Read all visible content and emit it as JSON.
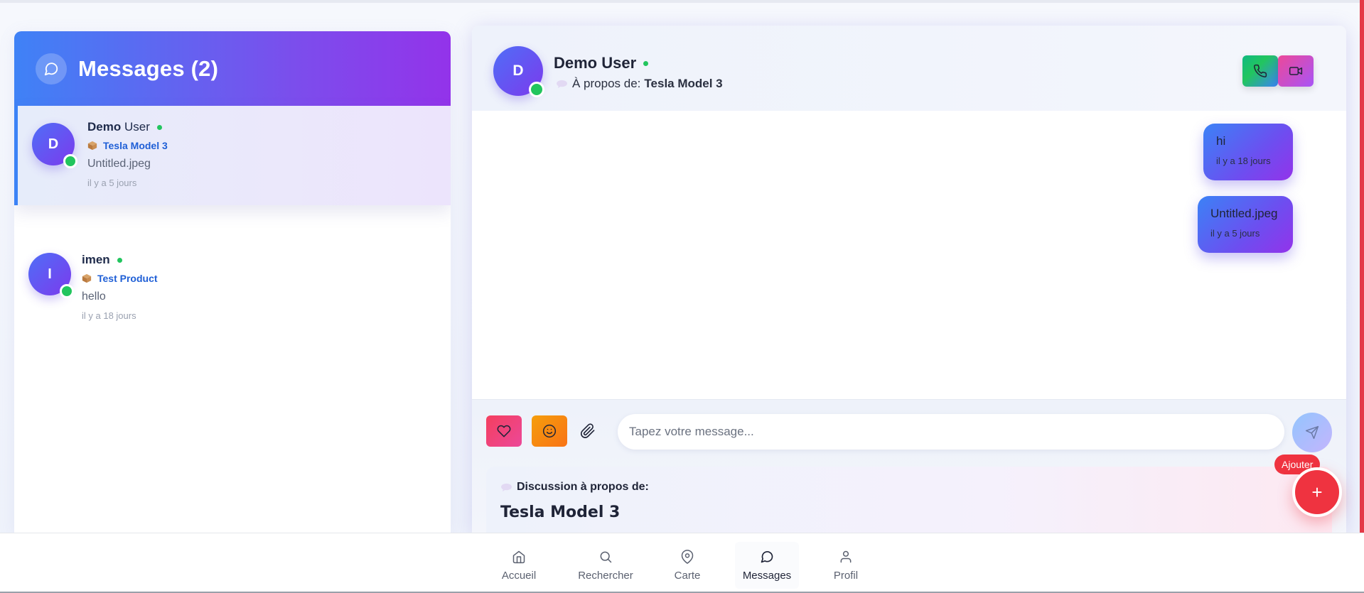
{
  "colors": {
    "accent_blue": "#3b82f6",
    "accent_purple": "#9333ea",
    "online_green": "#22c55e",
    "danger_red": "#ef3340",
    "product_link": "#1f5fd6"
  },
  "conversations": {
    "title": "Messages (2)",
    "items": [
      {
        "initial": "D",
        "name_first": "Demo",
        "name_last": "User",
        "product": "Tesla Model 3",
        "last_message": "Untitled.jpeg",
        "time": "il y a 5 jours",
        "online": true,
        "active": true
      },
      {
        "initial": "I",
        "name": "imen",
        "product": "Test Product",
        "last_message": "hello",
        "time": "il y a 18 jours",
        "online": true,
        "active": false
      }
    ]
  },
  "chat": {
    "contact_initial": "D",
    "contact_name": "Demo User",
    "about_prefix": "À propos de:",
    "about_product": "Tesla Model 3",
    "messages": [
      {
        "text": "hi",
        "time": "il y a 18 jours"
      },
      {
        "text": "Untitled.jpeg",
        "time": "il y a 5 jours"
      }
    ],
    "input_placeholder": "Tapez votre message...",
    "product_card": {
      "label": "Discussion à propos de:",
      "title": "Tesla Model 3"
    }
  },
  "fab": {
    "label": "Ajouter",
    "symbol": "+"
  },
  "nav": {
    "items": [
      {
        "label": "Accueil",
        "icon": "home-icon"
      },
      {
        "label": "Rechercher",
        "icon": "search-icon"
      },
      {
        "label": "Carte",
        "icon": "map-pin-icon"
      },
      {
        "label": "Messages",
        "icon": "message-circle-icon",
        "active": true
      },
      {
        "label": "Profil",
        "icon": "user-icon"
      }
    ]
  }
}
